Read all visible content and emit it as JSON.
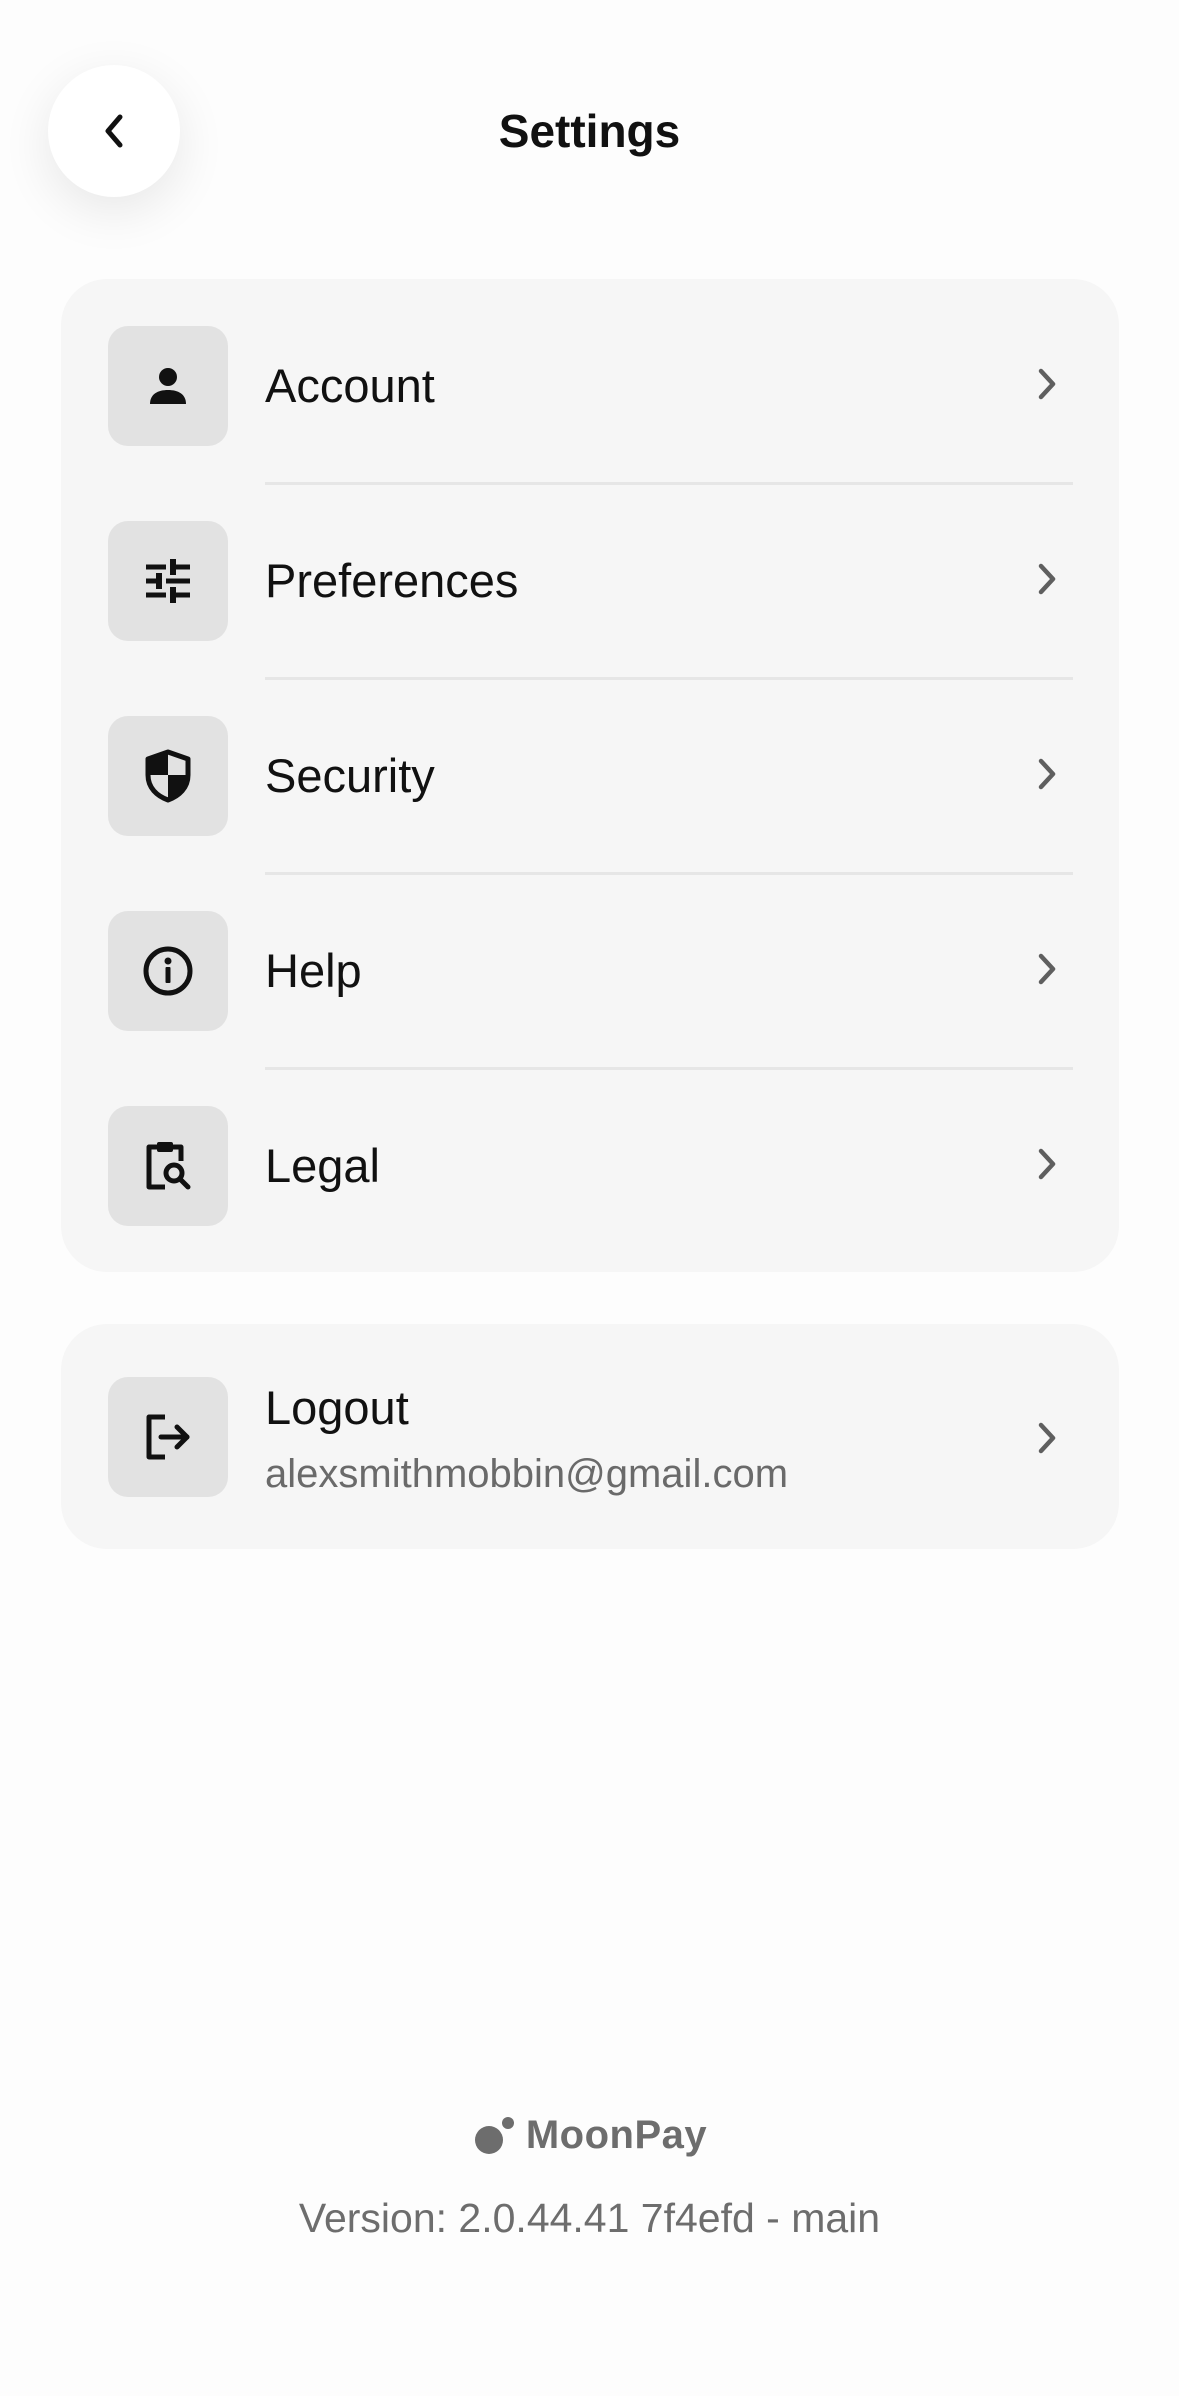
{
  "header": {
    "title": "Settings"
  },
  "menu": {
    "items": [
      {
        "id": "account",
        "label": "Account",
        "icon": "person-icon"
      },
      {
        "id": "preferences",
        "label": "Preferences",
        "icon": "sliders-icon"
      },
      {
        "id": "security",
        "label": "Security",
        "icon": "shield-icon"
      },
      {
        "id": "help",
        "label": "Help",
        "icon": "info-icon"
      },
      {
        "id": "legal",
        "label": "Legal",
        "icon": "clipboard-search-icon"
      }
    ]
  },
  "logout": {
    "label": "Logout",
    "email": "alexsmithmobbin@gmail.com",
    "icon": "logout-icon"
  },
  "footer": {
    "brand": "MoonPay",
    "version": "Version: 2.0.44.41 7f4efd - main"
  },
  "colors": {
    "background": "#fdfdfd",
    "card": "#f6f6f6",
    "icon_tile": "#e2e2e2",
    "text_primary": "#111111",
    "text_secondary": "#6a6a6a",
    "chevron": "#5f5f5f"
  }
}
